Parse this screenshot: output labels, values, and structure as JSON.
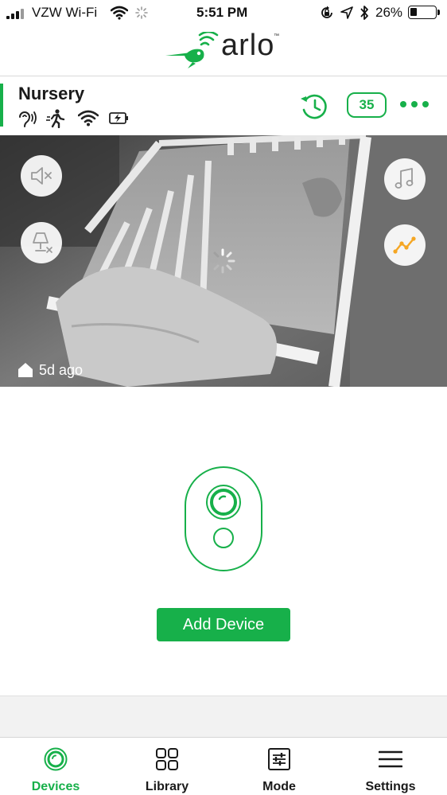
{
  "status_bar": {
    "carrier": "VZW Wi-Fi",
    "time": "5:51 PM",
    "battery_percent": "26%",
    "battery_level": 0.26,
    "icons": [
      "signal-icon",
      "wifi-icon",
      "activity-spinner-icon",
      "rotation-lock-icon",
      "location-icon",
      "bluetooth-icon",
      "battery-icon"
    ]
  },
  "brand": {
    "logo_text": "arlo",
    "logo_icon": "hummingbird-logo-icon"
  },
  "device": {
    "name": "Nursery",
    "status_icons": [
      "audio-detection-icon",
      "motion-detection-icon",
      "wifi-signal-icon",
      "battery-charging-icon"
    ],
    "activity_icon": "activity-history-icon",
    "event_count": "35",
    "more_icon": "more-dots-icon"
  },
  "feed": {
    "last_seen": "5d ago",
    "home_icon": "home-icon",
    "controls": {
      "left": [
        "speaker-muted-icon",
        "night-light-off-icon"
      ],
      "right": [
        "music-note-icon",
        "air-quality-graph-icon"
      ]
    },
    "loading_icon": "loading-spinner-icon"
  },
  "main": {
    "illustration_icon": "arlo-baby-camera-icon",
    "add_device_label": "Add Device"
  },
  "colors": {
    "accent": "#17b04a",
    "graph_accent": "#f5a623"
  },
  "tabs": [
    {
      "label": "Devices",
      "icon": "devices-icon",
      "active": true
    },
    {
      "label": "Library",
      "icon": "library-grid-icon",
      "active": false
    },
    {
      "label": "Mode",
      "icon": "mode-sliders-icon",
      "active": false
    },
    {
      "label": "Settings",
      "icon": "settings-menu-icon",
      "active": false
    }
  ]
}
